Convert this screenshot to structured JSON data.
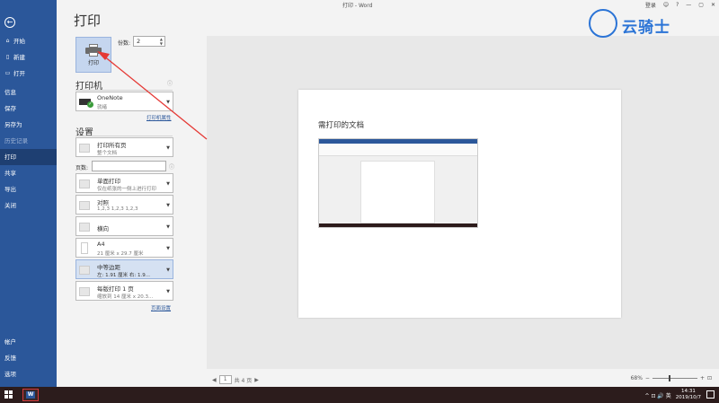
{
  "window": {
    "title": "打印 - Word",
    "login": "登录",
    "controls": [
      "☺",
      "?",
      "—",
      "▢",
      "✕"
    ]
  },
  "sidebar": {
    "back_icon": "back-arrow-icon",
    "items": [
      {
        "label": "开始",
        "icon": "home-icon",
        "glyph": "⌂"
      },
      {
        "label": "新建",
        "icon": "new-doc-icon",
        "glyph": "▯"
      },
      {
        "label": "打开",
        "icon": "open-folder-icon",
        "glyph": "▭"
      },
      {
        "label": "信息"
      },
      {
        "label": "保存"
      },
      {
        "label": "另存为"
      },
      {
        "label": "历史记录"
      },
      {
        "label": "打印"
      },
      {
        "label": "共享"
      },
      {
        "label": "导出"
      },
      {
        "label": "关闭"
      },
      {
        "label": "帐户"
      },
      {
        "label": "反馈"
      },
      {
        "label": "选项"
      }
    ]
  },
  "page": {
    "title": "打印"
  },
  "print": {
    "button_label": "打印",
    "copies_label": "份数:",
    "copies_value": "2"
  },
  "printer": {
    "section_title": "打印机",
    "name": "OneNote",
    "status": "就绪",
    "properties_link": "打印机属性"
  },
  "settings": {
    "section_title": "设置",
    "pages_label": "页数:",
    "pages_value": "",
    "page_setup_link": "页面设置",
    "items": [
      {
        "line1": "打印所有页",
        "line2": "整个文档"
      },
      {
        "line1": "单面打印",
        "line2": "仅在纸张的一侧上进行打印"
      },
      {
        "line1": "对照",
        "line2": "1,2,3    1,2,3    1,2,3"
      },
      {
        "line1": "横向",
        "line2": ""
      },
      {
        "line1": "A4",
        "line2": "21 厘米 x 29.7 厘米"
      },
      {
        "line1": "中等边距",
        "line2": "左: 1.91 厘米    右: 1.9..."
      },
      {
        "line1": "每版打印 1 页",
        "line2": "缩放到 14 厘米 x 20.3..."
      }
    ]
  },
  "preview": {
    "heading": "需打印的文档",
    "current_page": "1",
    "total_pages": "共 4 页",
    "zoom": "68%"
  },
  "taskbar": {
    "start_icon": "windows-start-icon",
    "app_icon": "word-app-icon",
    "word_letter": "W",
    "tray": "^ ⊡ 🔊 英",
    "time": "14:31",
    "date": "2019/10/7"
  },
  "watermark": {
    "text": "云骑士"
  }
}
